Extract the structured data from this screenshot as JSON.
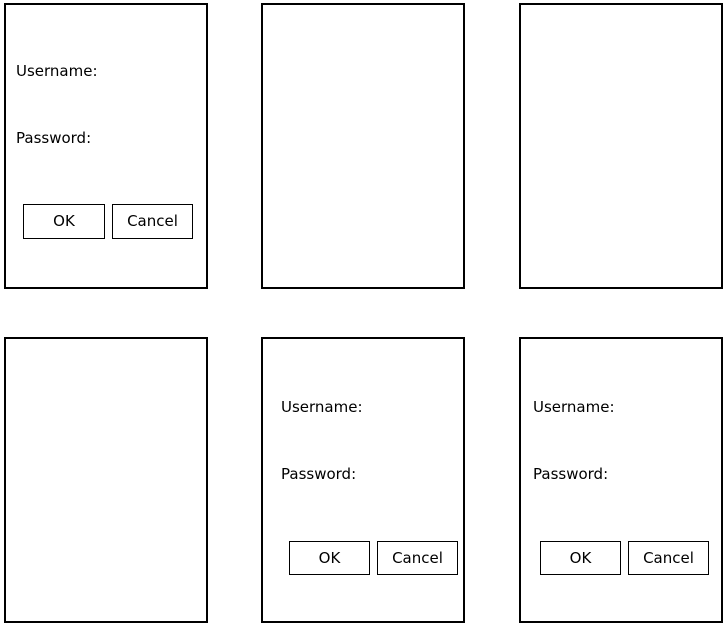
{
  "panels": {
    "top_left": {
      "username_label": "Username:",
      "password_label": "Password:",
      "ok_label": "OK",
      "cancel_label": "Cancel"
    },
    "bottom_middle": {
      "username_label": "Username:",
      "password_label": "Password:",
      "ok_label": "OK",
      "cancel_label": "Cancel"
    },
    "bottom_right": {
      "username_label": "Username:",
      "password_label": "Password:",
      "ok_label": "OK",
      "cancel_label": "Cancel"
    }
  },
  "colors": {
    "border": "#000000",
    "background": "#ffffff"
  }
}
